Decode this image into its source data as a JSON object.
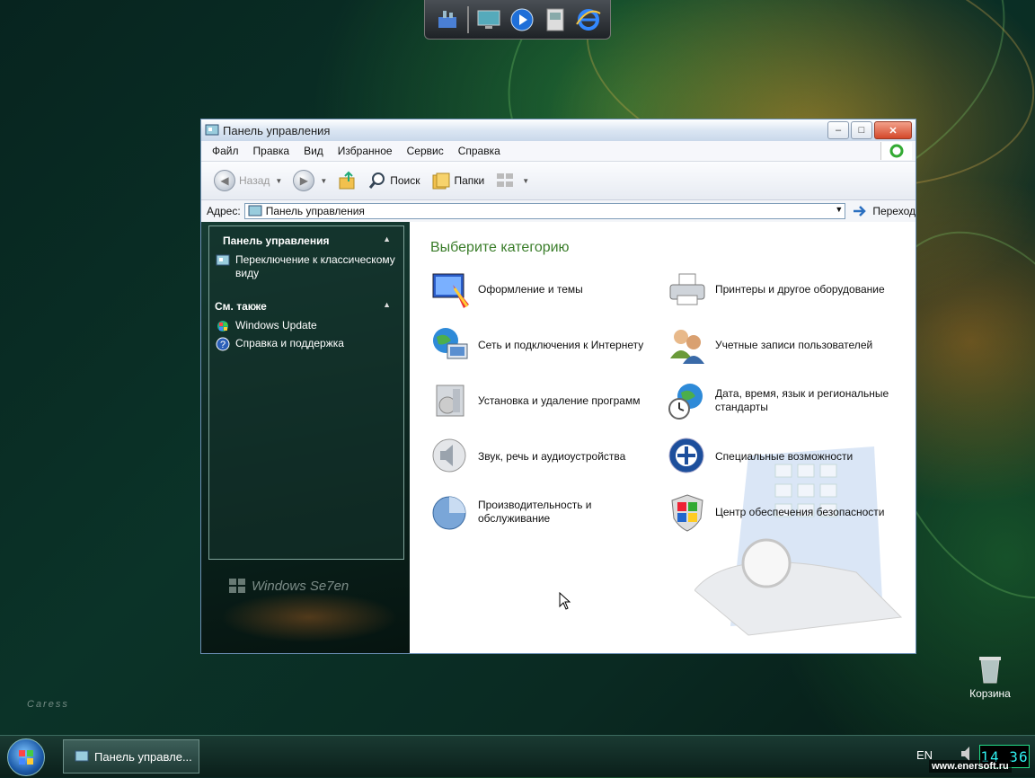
{
  "window": {
    "title": "Панель управления",
    "menu": [
      "Файл",
      "Правка",
      "Вид",
      "Избранное",
      "Сервис",
      "Справка"
    ],
    "toolbar": {
      "back": "Назад",
      "search": "Поиск",
      "folders": "Папки"
    },
    "address": {
      "label": "Адрес:",
      "value": "Панель управления",
      "go": "Переход"
    }
  },
  "sidebar": {
    "section1": {
      "title": "Панель управления",
      "link": "Переключение к классическому виду"
    },
    "section2": {
      "title": "См. также",
      "links": [
        "Windows Update",
        "Справка и поддержка"
      ]
    },
    "logo_text": "Windows Se7en"
  },
  "main": {
    "heading": "Выберите категорию",
    "categories": [
      "Оформление и темы",
      "Принтеры и другое оборудование",
      "Сеть и подключения к Интернету",
      "Учетные записи пользователей",
      "Установка и удаление программ",
      "Дата, время, язык и региональные стандарты",
      "Звук, речь и аудиоустройства",
      "Специальные возможности",
      "Производительность и обслуживание",
      "Центр обеспечения безопасности"
    ]
  },
  "desktop": {
    "recycle_bin": "Корзина",
    "caress": "Caress"
  },
  "taskbar": {
    "task_label": "Панель управле...",
    "lang": "EN",
    "clock": "14 36",
    "watermark": "www.enersoft.ru"
  }
}
